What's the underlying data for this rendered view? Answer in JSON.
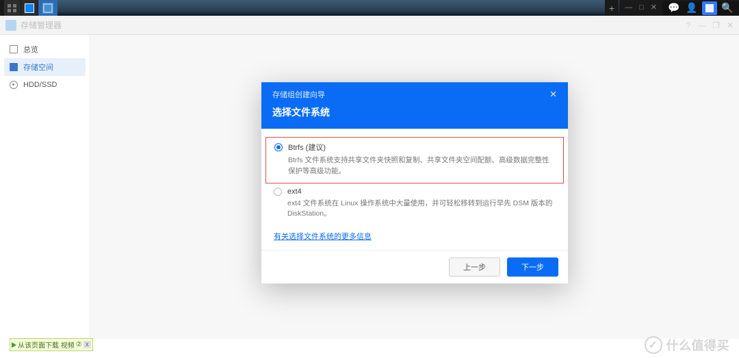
{
  "taskbar": {
    "plus": "+",
    "win": {
      "min": "—",
      "max": "□",
      "close": "✕"
    }
  },
  "app": {
    "title": "存储管理器",
    "header_right": {
      "pin": "?",
      "min": "—",
      "max": "❐",
      "close": "✕"
    }
  },
  "sidebar": {
    "items": [
      {
        "label": "总览"
      },
      {
        "label": "存储空间"
      },
      {
        "label": "HDD/SSD"
      }
    ]
  },
  "dialog": {
    "subtitle": "存储组创建向导",
    "close": "✕",
    "title": "选择文件系统",
    "options": [
      {
        "label": "Btrfs (建议)",
        "desc": "Btrfs 文件系统支持共享文件夹快照和复制、共享文件夹空间配额、高级数据完整性保护等高级功能。"
      },
      {
        "label": "ext4",
        "desc": "ext4 文件系统在 Linux 操作系统中大量使用，并可轻松移转到运行早先 DSM 版本的 DiskStation。"
      }
    ],
    "link": "有关选择文件系统的更多信息",
    "btn_back": "上一步",
    "btn_next": "下一步"
  },
  "footer": {
    "badge": "从该页面下载 视频",
    "badge_num": "②",
    "badge_x": "x"
  },
  "watermark": "什么值得买"
}
